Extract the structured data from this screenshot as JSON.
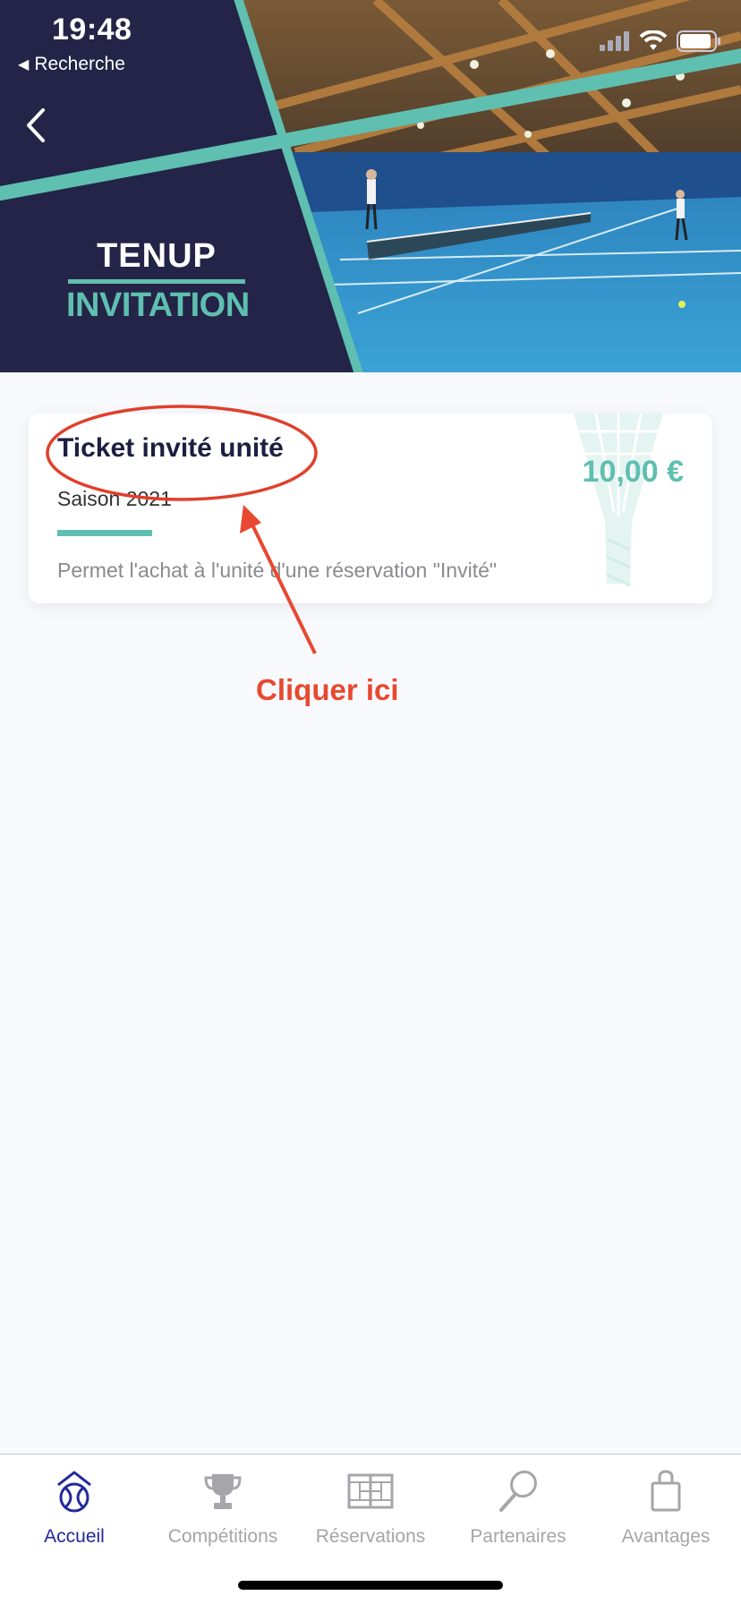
{
  "status_bar": {
    "time": "19:48",
    "back_app_label": "Recherche"
  },
  "header": {
    "logo_top": "TENUP",
    "logo_bottom": "INVITATION",
    "colors": {
      "navy": "#232447",
      "teal": "#5fbfb0"
    }
  },
  "card": {
    "title": "Ticket invité unité",
    "season": "Saison 2021",
    "description": "Permet l'achat à l'unité d'une réservation \"Invité\"",
    "price": "10,00 €"
  },
  "annotation": {
    "label": "Cliquer ici",
    "color": "#e8482f"
  },
  "tabbar": {
    "items": [
      {
        "label": "Accueil",
        "icon": "tennis-ball-home-icon",
        "active": true
      },
      {
        "label": "Compétitions",
        "icon": "trophy-icon",
        "active": false
      },
      {
        "label": "Réservations",
        "icon": "court-grid-icon",
        "active": false
      },
      {
        "label": "Partenaires",
        "icon": "racket-icon",
        "active": false
      },
      {
        "label": "Avantages",
        "icon": "shopping-bag-icon",
        "active": false
      }
    ]
  }
}
